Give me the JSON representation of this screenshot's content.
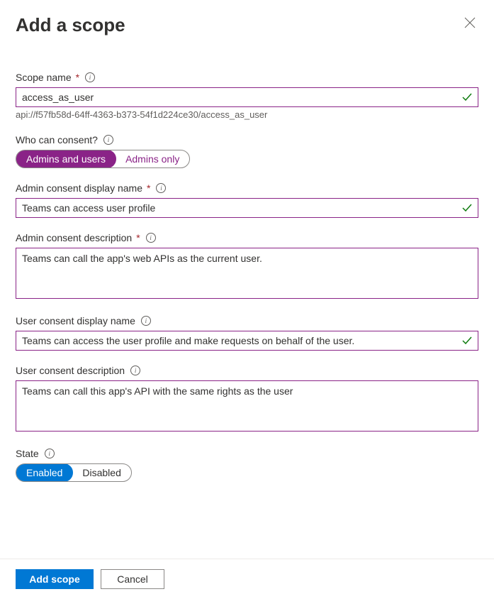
{
  "header": {
    "title": "Add a scope"
  },
  "scopeName": {
    "label": "Scope name",
    "value": "access_as_user",
    "helper": "api://f57fb58d-64ff-4363-b373-54f1d224ce30/access_as_user"
  },
  "consent": {
    "label": "Who can consent?",
    "option1": "Admins and users",
    "option2": "Admins only"
  },
  "adminDisplay": {
    "label": "Admin consent display name",
    "value": "Teams can access user profile"
  },
  "adminDesc": {
    "label": "Admin consent description",
    "value": "Teams can call the app's web APIs as the current user."
  },
  "userDisplay": {
    "label": "User consent display name",
    "value": "Teams can access the user profile and make requests on behalf of the user."
  },
  "userDesc": {
    "label": "User consent description",
    "value": "Teams can call this app's API with the same rights as the user"
  },
  "state": {
    "label": "State",
    "option1": "Enabled",
    "option2": "Disabled"
  },
  "footer": {
    "addScope": "Add scope",
    "cancel": "Cancel"
  }
}
